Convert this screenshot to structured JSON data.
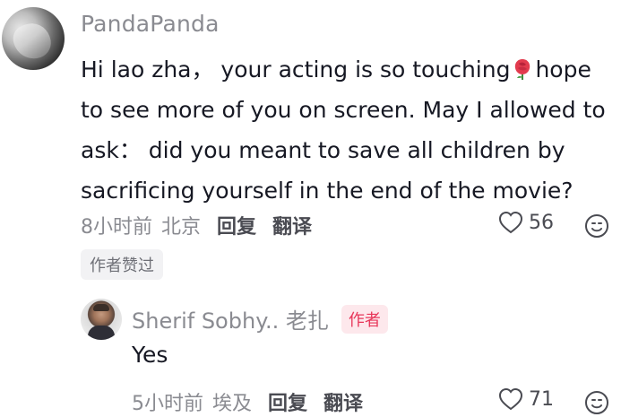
{
  "comment": {
    "username": "PandaPanda",
    "text_before_emoji": "Hi lao zha， your acting is so touching",
    "emoji_icon": "rose-icon",
    "text_after_emoji": "hope to see more of you on screen. May I allowed to ask： did you meant to save all children by sacrificing yourself in the end of the movie?",
    "time": "8小时前",
    "location": "北京",
    "reply_label": "回复",
    "translate_label": "翻译",
    "likes": "56",
    "badge": "作者赞过"
  },
  "reply": {
    "username": "Sherif Sobhy.. 老扎",
    "author_tag": "作者",
    "text": "Yes",
    "time": "5小时前",
    "location": "埃及",
    "reply_label": "回复",
    "translate_label": "翻译",
    "likes": "71"
  },
  "colors": {
    "primary_text": "#161823",
    "secondary_text": "#8a8b91",
    "author_tag_bg": "#fde8ec",
    "author_tag_text": "#e8375a",
    "rose": "#e23b4e"
  }
}
